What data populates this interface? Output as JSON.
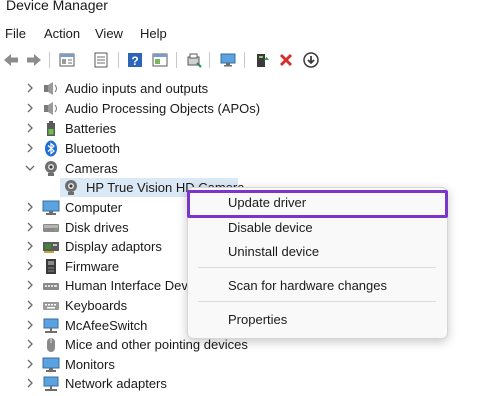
{
  "window": {
    "title": "Device Manager"
  },
  "menu": [
    "File",
    "Action",
    "View",
    "Help"
  ],
  "toolbar_icons": [
    "back-arrow-icon",
    "forward-arrow-icon",
    "properties-icon",
    "details-icon",
    "help-icon",
    "view-icon",
    "scan-icon",
    "monitor-icon",
    "update-driver-icon",
    "uninstall-icon",
    "download-icon"
  ],
  "tree": [
    {
      "label": "Audio inputs and outputs",
      "icon": "speaker-icon",
      "expanded": false
    },
    {
      "label": "Audio Processing Objects (APOs)",
      "icon": "speaker-icon",
      "expanded": false
    },
    {
      "label": "Batteries",
      "icon": "battery-icon",
      "expanded": false
    },
    {
      "label": "Bluetooth",
      "icon": "bluetooth-icon",
      "expanded": false
    },
    {
      "label": "Cameras",
      "icon": "camera-icon",
      "expanded": true
    },
    {
      "label": "HP True Vision HD Camera",
      "icon": "camera-icon",
      "child": true,
      "selected": true
    },
    {
      "label": "Computer",
      "icon": "computer-icon",
      "expanded": false
    },
    {
      "label": "Disk drives",
      "icon": "disk-drive-icon",
      "expanded": false
    },
    {
      "label": "Display adaptors",
      "icon": "display-adapter-icon",
      "expanded": false
    },
    {
      "label": "Firmware",
      "icon": "firmware-icon",
      "expanded": false
    },
    {
      "label": "Human Interface Devi",
      "icon": "hid-icon",
      "expanded": false
    },
    {
      "label": "Keyboards",
      "icon": "keyboard-icon",
      "expanded": false
    },
    {
      "label": "McAfeeSwitch",
      "icon": "network-icon",
      "expanded": false
    },
    {
      "label": "Mice and other pointing devices",
      "icon": "mouse-icon",
      "expanded": false
    },
    {
      "label": "Monitors",
      "icon": "monitor-icon",
      "expanded": false
    },
    {
      "label": "Network adapters",
      "icon": "network-icon",
      "expanded": false
    }
  ],
  "context_menu": {
    "items": [
      "Update driver",
      "Disable device",
      "Uninstall device",
      "Scan for hardware changes",
      "Properties"
    ],
    "highlighted": "Update driver",
    "highlight_color": "#7b35c9"
  },
  "colors": {
    "selection": "#dbe8f5",
    "delete_red": "#d32f2f",
    "help_blue": "#2b64b8"
  }
}
